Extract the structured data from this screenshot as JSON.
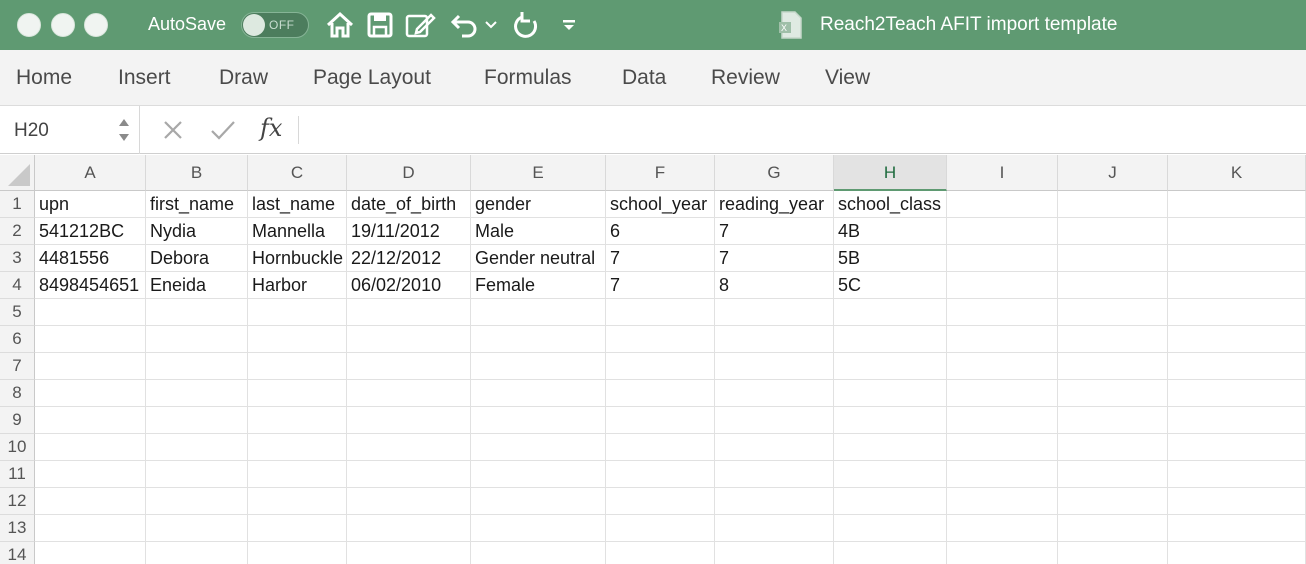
{
  "titlebar": {
    "autosave_label": "AutoSave",
    "autosave_state": "OFF",
    "document_title": "Reach2Teach AFIT import template",
    "bg_color": "#5f9a72",
    "icons": [
      "home-icon",
      "save-icon",
      "edit-document-icon",
      "undo-icon",
      "chevron-down-icon",
      "redo-icon",
      "customize-toolbar-icon",
      "excel-document-icon"
    ]
  },
  "ribbon": {
    "tabs": [
      "Home",
      "Insert",
      "Draw",
      "Page Layout",
      "Formulas",
      "Data",
      "Review",
      "View"
    ]
  },
  "formula_bar": {
    "name_box": "H20",
    "fx_label": "fx",
    "formula": ""
  },
  "sheet": {
    "columns": [
      "A",
      "B",
      "C",
      "D",
      "E",
      "F",
      "G",
      "H",
      "I",
      "J",
      "K"
    ],
    "active_column": "H",
    "rows": [
      [
        "upn",
        "first_name",
        "last_name",
        "date_of_birth",
        "gender",
        "school_year",
        "reading_year",
        "school_class",
        "",
        "",
        ""
      ],
      [
        "541212BC",
        "Nydia",
        "Mannella",
        "19/11/2012",
        "Male",
        "6",
        "7",
        "4B",
        "",
        "",
        ""
      ],
      [
        "4481556",
        "Debora",
        "Hornbuckle",
        "22/12/2012",
        "Gender neutral",
        "7",
        "7",
        "5B",
        "",
        "",
        ""
      ],
      [
        "8498454651",
        "Eneida",
        "Harbor",
        "06/02/2010",
        "Female",
        "7",
        "8",
        "5C",
        "",
        "",
        ""
      ],
      [
        "",
        "",
        "",
        "",
        "",
        "",
        "",
        "",
        "",
        "",
        ""
      ],
      [
        "",
        "",
        "",
        "",
        "",
        "",
        "",
        "",
        "",
        "",
        ""
      ],
      [
        "",
        "",
        "",
        "",
        "",
        "",
        "",
        "",
        "",
        "",
        ""
      ],
      [
        "",
        "",
        "",
        "",
        "",
        "",
        "",
        "",
        "",
        "",
        ""
      ],
      [
        "",
        "",
        "",
        "",
        "",
        "",
        "",
        "",
        "",
        "",
        ""
      ],
      [
        "",
        "",
        "",
        "",
        "",
        "",
        "",
        "",
        "",
        "",
        ""
      ],
      [
        "",
        "",
        "",
        "",
        "",
        "",
        "",
        "",
        "",
        "",
        ""
      ],
      [
        "",
        "",
        "",
        "",
        "",
        "",
        "",
        "",
        "",
        "",
        ""
      ],
      [
        "",
        "",
        "",
        "",
        "",
        "",
        "",
        "",
        "",
        "",
        ""
      ],
      [
        "",
        "",
        "",
        "",
        "",
        "",
        "",
        "",
        "",
        "",
        ""
      ]
    ],
    "row_numbers": [
      "1",
      "2",
      "3",
      "4",
      "5",
      "6",
      "7",
      "8",
      "9",
      "10",
      "11",
      "12",
      "13",
      "14"
    ]
  }
}
